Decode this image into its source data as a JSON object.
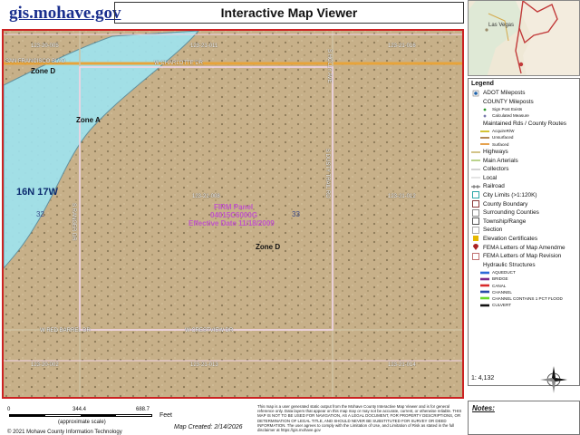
{
  "header": {
    "logo": "gis.mohave.gov",
    "title": "Interactive Map Viewer"
  },
  "map": {
    "parcels": {
      "p1": "123-20-005",
      "p2": "123-21-011",
      "p3": "123-21-016",
      "p4": "123-21-008",
      "p5": "123-21-012",
      "p6": "123-20-002",
      "p7": "123-21-013",
      "p8": "123-21-014"
    },
    "roads": {
      "r1": "S HOLLY AVE",
      "r2": "SAN FRANCISCO BLVD",
      "r3": "W CHARLOTTE DR",
      "r4": "S RANGER DR",
      "r5": "S DUSTY TRAIL RD",
      "r6": "W RED BARREL DR",
      "r7": "W CRESTVIEW DR"
    },
    "zones": {
      "z1": "Zone D",
      "z2": "Zone A",
      "z3": "Zone D"
    },
    "township": "16N 17W",
    "section_left": "32",
    "section_right": "33",
    "firm": {
      "line1": "FIRM Panel",
      "line2": "04015C6000G",
      "line3": "Effective Date 11/18/2009"
    },
    "colors": {
      "flood_zone_a": "#9fe3ee",
      "parcel_boundary": "#f1d6ea",
      "frame": "#cc2222"
    }
  },
  "scale": {
    "t0": "0",
    "t1": "344.4",
    "t2": "688.7",
    "unit": "Feet",
    "note": "(approximate scale)",
    "ratio": "1: 4,132"
  },
  "footer": {
    "map_created": "Map Created: 2/14/2026",
    "copyright": "© 2021 Mohave County Information Technology",
    "disclaimer": "This map is a user generated static output from the Mohave County Interactive Map Viewer and is for general reference only. Data layers that appear on this map may or may not be accurate, current, or otherwise reliable. THIS MAP IS NOT TO BE USED FOR NAVIGATION, AS A LEGAL DOCUMENT, FOR PROPERTY DESCRIPTIONS, OR DETERMINATION OF LEGAL TITLE, AND SHOULD NEVER BE SUBSTITUTED FOR SURVEY OR DEED INFORMATION. The user agrees to comply with the Limitation of Use, and Limitation of Risk as stated in the full disclaimer at https://gis.mohave.gov"
  },
  "inset": {
    "label": "Las Vegas"
  },
  "legend": {
    "title": "Legend",
    "items": [
      {
        "label": "ADOT Mileposts",
        "icon": "square-dot",
        "color": "#1a5fa8",
        "sub": false
      },
      {
        "label": "COUNTY Mileposts",
        "icon": "none",
        "color": "#000000",
        "sub": false
      },
      {
        "label": "Sign Post Exists",
        "icon": "small-dot",
        "color": "#2a9a2a",
        "sub": true
      },
      {
        "label": "Calculated Measure",
        "icon": "small-dot",
        "color": "#7777aa",
        "sub": true
      },
      {
        "label": "Maintained Rds / County Routes",
        "icon": "none",
        "color": "#000000",
        "sub": false
      },
      {
        "label": "AcquireR/W",
        "icon": "line",
        "color": "#c8b400",
        "sub": true
      },
      {
        "label": "Unsurfaced",
        "icon": "line",
        "color": "#a06a2a",
        "sub": true
      },
      {
        "label": "Surfaced",
        "icon": "line",
        "color": "#e08a20",
        "sub": true
      },
      {
        "label": "Highways",
        "icon": "line",
        "color": "#c8b46a",
        "sub": false
      },
      {
        "label": "Main Arterials",
        "icon": "line",
        "color": "#a8c870",
        "sub": false
      },
      {
        "label": "Collectors",
        "icon": "line",
        "color": "#c8c8c8",
        "sub": false
      },
      {
        "label": "Local",
        "icon": "line",
        "color": "#dddddd",
        "sub": false
      },
      {
        "label": "Railroad",
        "icon": "rail",
        "color": "#555555",
        "sub": false
      },
      {
        "label": "City Limits (>1:120K)",
        "icon": "box",
        "color": "#2aa6a6",
        "sub": false
      },
      {
        "label": "County Boundary",
        "icon": "box",
        "color": "#8a3a3a",
        "sub": false
      },
      {
        "label": "Surrounding Counties",
        "icon": "box",
        "color": "#888888",
        "sub": false
      },
      {
        "label": "Township/Range",
        "icon": "box",
        "color": "#555555",
        "sub": false
      },
      {
        "label": "Section",
        "icon": "box",
        "color": "#aaaaaa",
        "sub": false
      },
      {
        "label": "Elevation Certificates",
        "icon": "square-fill",
        "color": "#e6b800",
        "sub": false
      },
      {
        "label": "FEMA Letters of Map Amendme",
        "icon": "marker",
        "color": "#aa2222",
        "sub": false
      },
      {
        "label": "FEMA Letters of Map Revision",
        "icon": "box",
        "color": "#c07070",
        "sub": false
      },
      {
        "label": "Hydraulic Structures",
        "icon": "none",
        "color": "#000000",
        "sub": false
      },
      {
        "label": "AQUEDUCT",
        "icon": "thick-line",
        "color": "#2a6ad8",
        "sub": true
      },
      {
        "label": "BRIDGE",
        "icon": "thick-line",
        "color": "#7a2a8a",
        "sub": true
      },
      {
        "label": "CANAL",
        "icon": "thick-line",
        "color": "#d82a2a",
        "sub": true
      },
      {
        "label": "CHANNEL",
        "icon": "thick-line",
        "color": "#2a4aa8",
        "sub": true
      },
      {
        "label": "CHANNEL CONTAINS 1 PCT FLOOD",
        "icon": "thick-line",
        "color": "#6ad82a",
        "sub": true
      },
      {
        "label": "CULVERT",
        "icon": "thick-line",
        "color": "#111111",
        "sub": true
      }
    ]
  },
  "notes": {
    "label": "Notes:"
  }
}
